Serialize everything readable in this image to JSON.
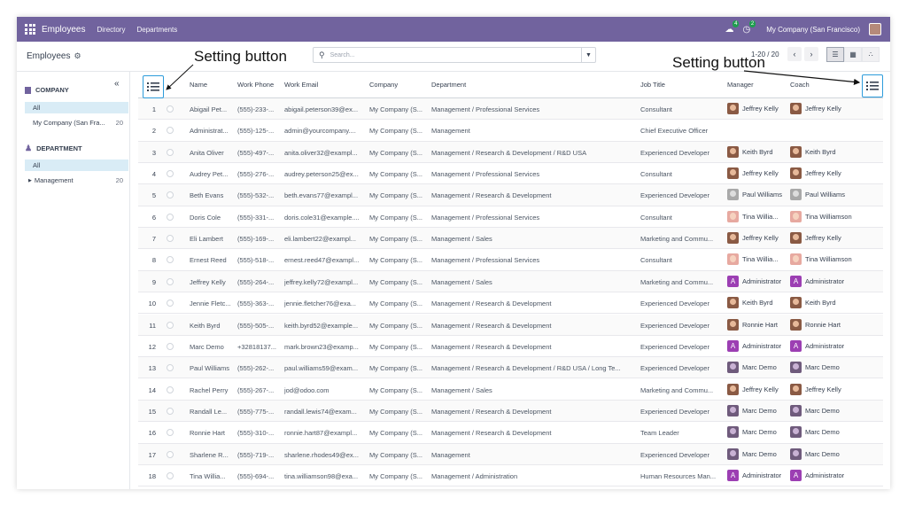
{
  "navbar": {
    "app_name": "Employees",
    "links": [
      "Directory",
      "Departments"
    ],
    "chat_badge": "4",
    "activity_badge": "2",
    "company": "My Company (San Francisco)"
  },
  "control": {
    "breadcrumb": "Employees",
    "search_placeholder": "Search...",
    "pager": "1-20 / 20"
  },
  "sidebar": {
    "company_title": "COMPANY",
    "company_items": [
      {
        "label": "All",
        "count": ""
      },
      {
        "label": "My Company (San Fra...",
        "count": "20"
      }
    ],
    "department_title": "DEPARTMENT",
    "department_items": [
      {
        "label": "All",
        "count": ""
      },
      {
        "label": "Management",
        "count": "20"
      }
    ]
  },
  "table": {
    "headers": {
      "name": "Name",
      "work_phone": "Work Phone",
      "work_email": "Work Email",
      "company": "Company",
      "department": "Department",
      "job_title": "Job Title",
      "manager": "Manager",
      "coach": "Coach"
    },
    "rows": [
      {
        "num": "1",
        "name": "Abigail Pet...",
        "phone": "(555)-233-...",
        "email": "abigail.peterson39@ex...",
        "company": "My Company (S...",
        "department": "Management / Professional Services",
        "job": "Consultant",
        "manager": "Jeffrey Kelly",
        "coach": "Jeffrey Kelly"
      },
      {
        "num": "2",
        "name": "Administrat...",
        "phone": "(555)-125-...",
        "email": "admin@yourcompany....",
        "company": "My Company (S...",
        "department": "Management",
        "job": "Chief Executive Officer",
        "manager": "",
        "coach": ""
      },
      {
        "num": "3",
        "name": "Anita Oliver",
        "phone": "(555)-497-...",
        "email": "anita.oliver32@exampl...",
        "company": "My Company (S...",
        "department": "Management / Research & Development / R&D USA",
        "job": "Experienced Developer",
        "manager": "Keith Byrd",
        "coach": "Keith Byrd"
      },
      {
        "num": "4",
        "name": "Audrey Pet...",
        "phone": "(555)-276-...",
        "email": "audrey.peterson25@ex...",
        "company": "My Company (S...",
        "department": "Management / Professional Services",
        "job": "Consultant",
        "manager": "Jeffrey Kelly",
        "coach": "Jeffrey Kelly"
      },
      {
        "num": "5",
        "name": "Beth Evans",
        "phone": "(555)-532-...",
        "email": "beth.evans77@exampl...",
        "company": "My Company (S...",
        "department": "Management / Research & Development",
        "job": "Experienced Developer",
        "manager": "Paul Williams",
        "coach": "Paul Williams"
      },
      {
        "num": "6",
        "name": "Doris Cole",
        "phone": "(555)-331-...",
        "email": "doris.cole31@example....",
        "company": "My Company (S...",
        "department": "Management / Professional Services",
        "job": "Consultant",
        "manager": "Tina Willia...",
        "coach": "Tina Williamson"
      },
      {
        "num": "7",
        "name": "Eli Lambert",
        "phone": "(555)-169-...",
        "email": "eli.lambert22@exampl...",
        "company": "My Company (S...",
        "department": "Management / Sales",
        "job": "Marketing and Commu...",
        "manager": "Jeffrey Kelly",
        "coach": "Jeffrey Kelly"
      },
      {
        "num": "8",
        "name": "Ernest Reed",
        "phone": "(555)-518-...",
        "email": "ernest.reed47@exampl...",
        "company": "My Company (S...",
        "department": "Management / Professional Services",
        "job": "Consultant",
        "manager": "Tina Willia...",
        "coach": "Tina Williamson"
      },
      {
        "num": "9",
        "name": "Jeffrey Kelly",
        "phone": "(555)-264-...",
        "email": "jeffrey.kelly72@exampl...",
        "company": "My Company (S...",
        "department": "Management / Sales",
        "job": "Marketing and Commu...",
        "manager": "Administrator",
        "coach": "Administrator"
      },
      {
        "num": "10",
        "name": "Jennie Fletc...",
        "phone": "(555)-363-...",
        "email": "jennie.fletcher76@exa...",
        "company": "My Company (S...",
        "department": "Management / Research & Development",
        "job": "Experienced Developer",
        "manager": "Keith Byrd",
        "coach": "Keith Byrd"
      },
      {
        "num": "11",
        "name": "Keith Byrd",
        "phone": "(555)-505-...",
        "email": "keith.byrd52@example...",
        "company": "My Company (S...",
        "department": "Management / Research & Development",
        "job": "Experienced Developer",
        "manager": "Ronnie Hart",
        "coach": "Ronnie Hart"
      },
      {
        "num": "12",
        "name": "Marc Demo",
        "phone": "+32818137...",
        "email": "mark.brown23@examp...",
        "company": "My Company (S...",
        "department": "Management / Research & Development",
        "job": "Experienced Developer",
        "manager": "Administrator",
        "coach": "Administrator"
      },
      {
        "num": "13",
        "name": "Paul Williams",
        "phone": "(555)-262-...",
        "email": "paul.williams59@exam...",
        "company": "My Company (S...",
        "department": "Management / Research & Development / R&D USA / Long Te...",
        "job": "Experienced Developer",
        "manager": "Marc Demo",
        "coach": "Marc Demo"
      },
      {
        "num": "14",
        "name": "Rachel Perry",
        "phone": "(555)-267-...",
        "email": "jod@odoo.com",
        "company": "My Company (S...",
        "department": "Management / Sales",
        "job": "Marketing and Commu...",
        "manager": "Jeffrey Kelly",
        "coach": "Jeffrey Kelly"
      },
      {
        "num": "15",
        "name": "Randall Le...",
        "phone": "(555)-775-...",
        "email": "randall.lewis74@exam...",
        "company": "My Company (S...",
        "department": "Management / Research & Development",
        "job": "Experienced Developer",
        "manager": "Marc Demo",
        "coach": "Marc Demo"
      },
      {
        "num": "16",
        "name": "Ronnie Hart",
        "phone": "(555)-310-...",
        "email": "ronnie.hart87@exampl...",
        "company": "My Company (S...",
        "department": "Management / Research & Development",
        "job": "Team Leader",
        "manager": "Marc Demo",
        "coach": "Marc Demo"
      },
      {
        "num": "17",
        "name": "Sharlene R...",
        "phone": "(555)-719-...",
        "email": "sharlene.rhodes49@ex...",
        "company": "My Company (S...",
        "department": "Management",
        "job": "Experienced Developer",
        "manager": "Marc Demo",
        "coach": "Marc Demo"
      },
      {
        "num": "18",
        "name": "Tina Willia...",
        "phone": "(555)-694-...",
        "email": "tina.williamson98@exa...",
        "company": "My Company (S...",
        "department": "Management / Administration",
        "job": "Human Resources Man...",
        "manager": "Administrator",
        "coach": "Administrator"
      }
    ]
  },
  "annotations": {
    "left": "Setting button",
    "right": "Setting button"
  },
  "colors": {
    "navbar": "#71639e",
    "highlight": "#2d9cdb",
    "selected": "#d9ecf6"
  }
}
